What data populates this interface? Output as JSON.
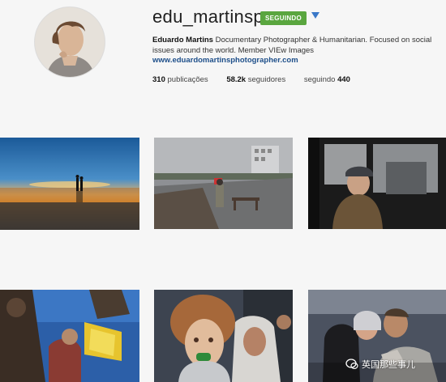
{
  "profile": {
    "username": "edu_martinsp",
    "follow_label": "SEGUINDO",
    "bio_name": "Eduardo Martins",
    "bio_text": " Documentary Photographer & Humanitarian. Focused on social issues around the world. Member VIEw Images",
    "website": "www.eduardomartinsphotographer.com"
  },
  "stats": {
    "posts_count": "310",
    "posts_label": "publicações",
    "followers_count": "58.2k",
    "followers_label": "seguidores",
    "following_label": "seguindo",
    "following_count": "440"
  },
  "watermark": {
    "text": "英国那些事儿"
  },
  "colors": {
    "follow_green": "#5aa63f",
    "link_blue": "#1e4f8a",
    "dropdown_blue": "#3a78c8"
  }
}
